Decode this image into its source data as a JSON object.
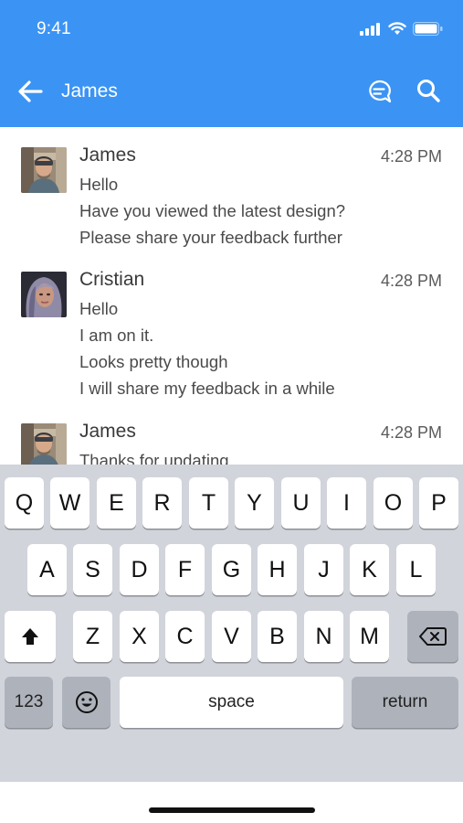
{
  "status_bar": {
    "time": "9:41"
  },
  "nav": {
    "title": "James"
  },
  "colors": {
    "header": "#3b94f4",
    "keyboard": "#d1d4db"
  },
  "messages": [
    {
      "sender": "James",
      "time": "4:28 PM",
      "lines": [
        "Hello",
        "Have you viewed the latest design?",
        "Please share your feedback further"
      ]
    },
    {
      "sender": "Cristian",
      "time": "4:28 PM",
      "lines": [
        "Hello",
        "I am on it.",
        "Looks pretty though",
        "I will share my feedback in a while"
      ]
    },
    {
      "sender": "James",
      "time": "4:28 PM",
      "lines": [
        "Thanks for updating"
      ]
    }
  ],
  "keyboard": {
    "row1": [
      "Q",
      "W",
      "E",
      "R",
      "T",
      "Y",
      "U",
      "I",
      "O",
      "P"
    ],
    "row2": [
      "A",
      "S",
      "D",
      "F",
      "G",
      "H",
      "J",
      "K",
      "L"
    ],
    "row3": [
      "Z",
      "X",
      "C",
      "V",
      "B",
      "N",
      "M"
    ],
    "numbers_label": "123",
    "space_label": "space",
    "return_label": "return",
    "icons": [
      "shift-icon",
      "backspace-icon",
      "emoji-icon"
    ]
  }
}
